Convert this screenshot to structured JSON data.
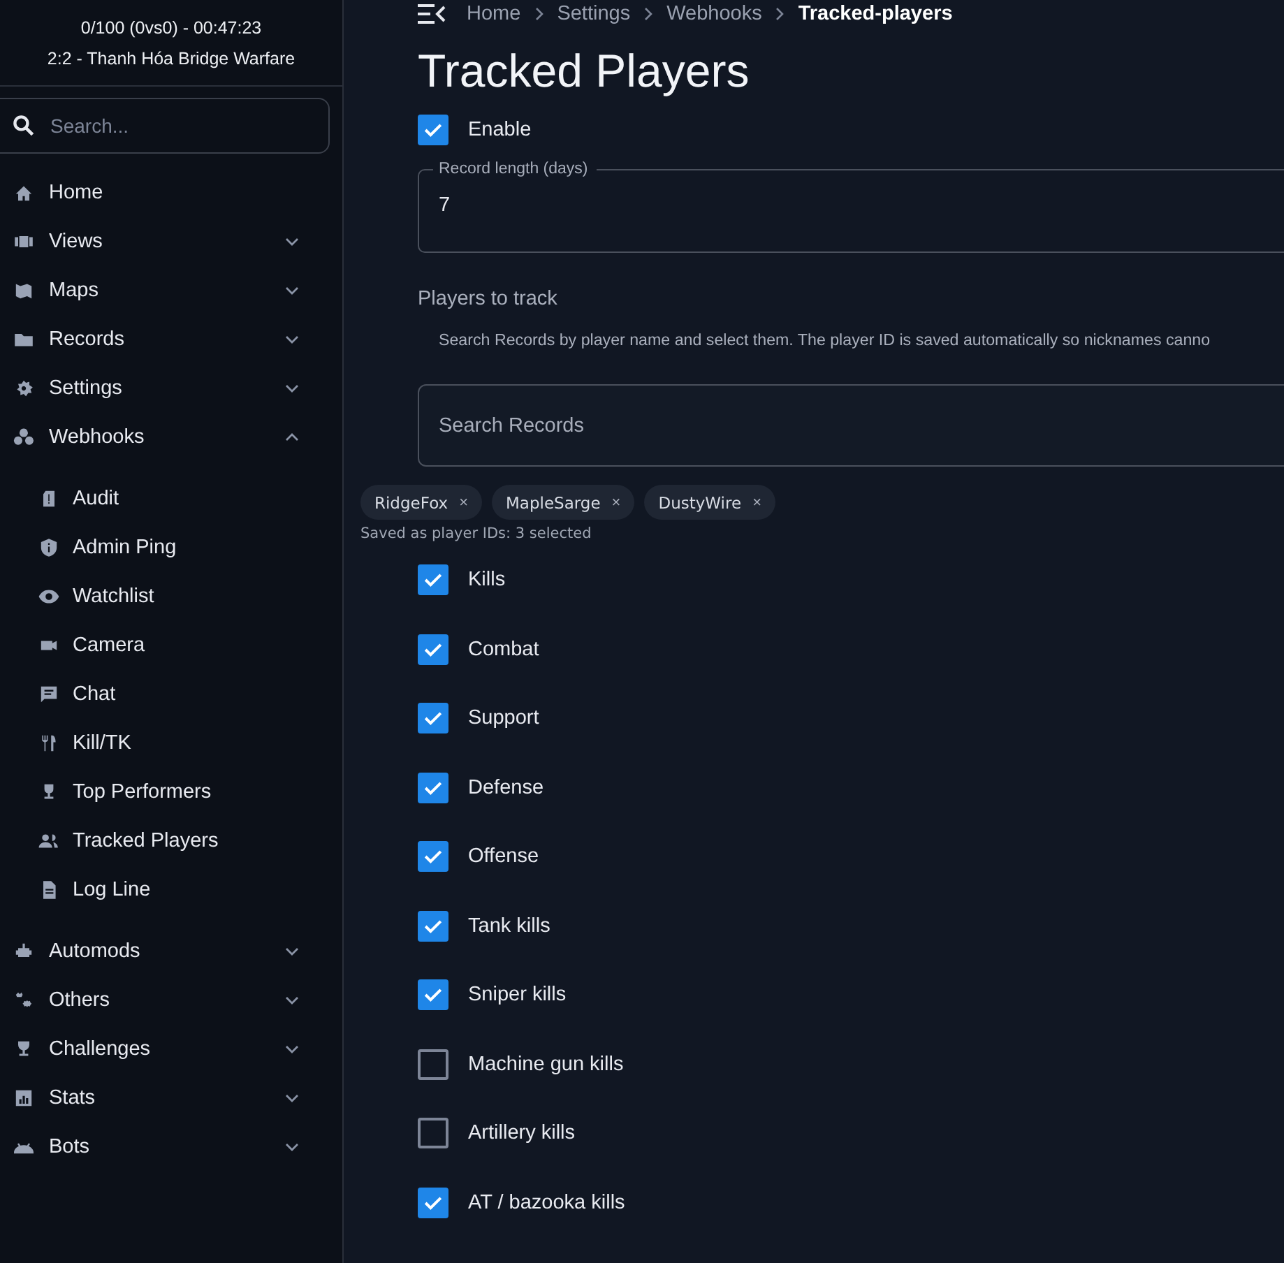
{
  "sidebar": {
    "status": [
      "0/100 (0vs0) - 00:47:23",
      "2:2 - Thanh Hóa Bridge Warfare"
    ],
    "search": {
      "placeholder": "Search..."
    },
    "items": [
      {
        "label": "Home"
      },
      {
        "label": "Views",
        "expanded": false
      },
      {
        "label": "Maps",
        "expanded": false
      },
      {
        "label": "Records",
        "expanded": false
      },
      {
        "label": "Settings",
        "expanded": false
      },
      {
        "label": "Webhooks",
        "expanded": true,
        "children": [
          {
            "label": "Audit"
          },
          {
            "label": "Admin Ping"
          },
          {
            "label": "Watchlist"
          },
          {
            "label": "Camera"
          },
          {
            "label": "Chat"
          },
          {
            "label": "Kill/TK"
          },
          {
            "label": "Top Performers"
          },
          {
            "label": "Tracked Players"
          },
          {
            "label": "Log Line"
          }
        ]
      },
      {
        "label": "Automods",
        "expanded": false
      },
      {
        "label": "Others",
        "expanded": false
      },
      {
        "label": "Challenges",
        "expanded": false
      },
      {
        "label": "Stats",
        "expanded": false
      },
      {
        "label": "Bots",
        "expanded": false
      }
    ]
  },
  "breadcrumb": [
    "Home",
    "Settings",
    "Webhooks",
    "Tracked-players"
  ],
  "title": "Tracked Players",
  "enable": {
    "label": "Enable",
    "checked": true
  },
  "record_length": {
    "label": "Record length (days)",
    "value": "7"
  },
  "players": {
    "heading": "Players to track",
    "hint": "Search Records by player name and select them. The player ID is saved automatically so nicknames canno",
    "search": {
      "placeholder": "Search Records"
    },
    "chips": [
      {
        "label": "RidgeFox",
        "remove": "×"
      },
      {
        "label": "MapleSarge",
        "remove": "×"
      },
      {
        "label": "DustyWire",
        "remove": "×"
      }
    ],
    "summary": "Saved as player IDs: 3 selected"
  },
  "options": [
    {
      "label": "Kills",
      "checked": true
    },
    {
      "label": "Combat",
      "checked": true
    },
    {
      "label": "Support",
      "checked": true
    },
    {
      "label": "Defense",
      "checked": true
    },
    {
      "label": "Offense",
      "checked": true
    },
    {
      "label": "Tank kills",
      "checked": true
    },
    {
      "label": "Sniper kills",
      "checked": true
    },
    {
      "label": "Machine gun kills",
      "checked": false
    },
    {
      "label": "Artillery kills",
      "checked": false
    },
    {
      "label": "AT / bazooka kills",
      "checked": true
    }
  ]
}
